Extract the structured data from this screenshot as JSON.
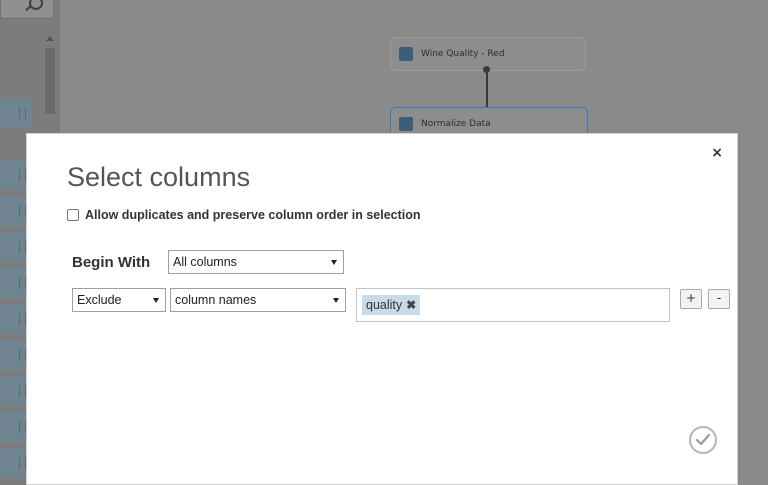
{
  "background": {
    "node_top_label": "Wine Quality - Red",
    "node_mid_label": "Normalize Data"
  },
  "dialog": {
    "title": "Select columns",
    "close_label": "×",
    "allow_duplicates_label": "Allow duplicates and preserve column order in selection",
    "begin_with_label": "Begin With",
    "begin_with_value": "All columns",
    "rule": {
      "mode": "Exclude",
      "type": "column names",
      "tags": [
        "quality"
      ]
    },
    "add_label": "+",
    "remove_label": "-",
    "confirm_icon": "check-icon"
  }
}
